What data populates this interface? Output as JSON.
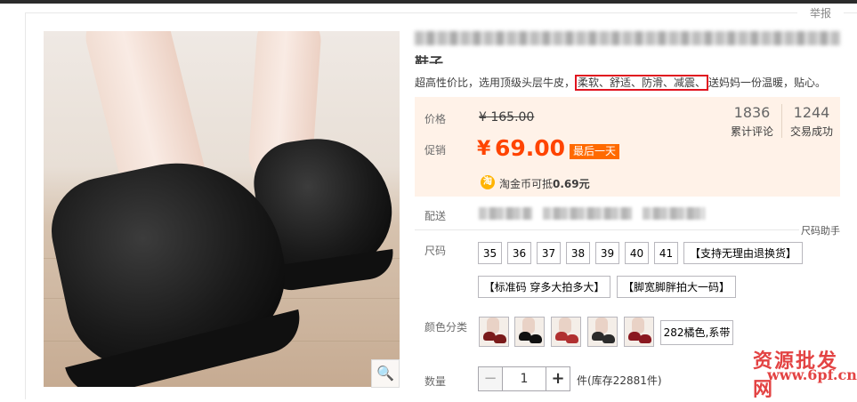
{
  "header": {
    "report_label": "举报"
  },
  "product": {
    "title_tail": "鞋子",
    "subtitle_before": "超高性价比，选用顶级头层牛皮，",
    "subtitle_highlight": "柔软、舒适、防滑、减震、",
    "subtitle_after": "送妈妈一份温暖，贴心。"
  },
  "price": {
    "price_label": "价格",
    "original": "¥ 165.00",
    "promo_label": "促销",
    "currency": "¥",
    "sale": "69.00",
    "promo_tag": "最后一天",
    "coin_icon_glyph": "淘",
    "coin_text": "淘金币可抵",
    "coin_value": "0.69元"
  },
  "stats": [
    {
      "value": "1836",
      "label": "累计评论"
    },
    {
      "value": "1244",
      "label": "交易成功"
    }
  ],
  "shipping": {
    "label": "配送"
  },
  "size": {
    "label": "尺码",
    "help": "尺码助手",
    "options": [
      "35",
      "36",
      "37",
      "38",
      "39",
      "40",
      "41"
    ],
    "notes": [
      "【支持无理由退换货】",
      "【标准码 穿多大拍多大】",
      "【脚宽脚胖拍大一码】"
    ]
  },
  "color": {
    "label": "颜色分类",
    "swatch_colors": [
      "#7a1a1a",
      "#111111",
      "#b03030",
      "#2b2b2b",
      "#8a1820"
    ],
    "text_option": "282橘色,系带"
  },
  "quantity": {
    "label": "数量",
    "minus": "−",
    "value": "1",
    "plus": "+",
    "stock": "件(库存22881件)"
  },
  "watermark": {
    "text": "资源批发网",
    "url": "www.6pf.cn"
  },
  "image": {
    "zoom_icon": "🔍"
  }
}
